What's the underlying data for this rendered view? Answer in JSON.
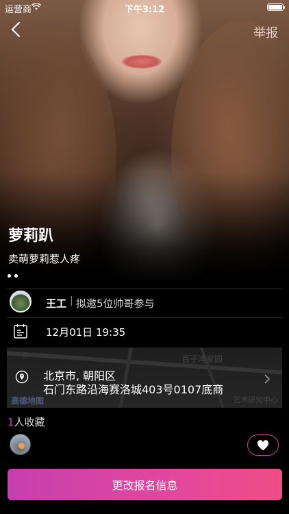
{
  "status_bar": {
    "carrier": "运营商",
    "time": "下午3:12"
  },
  "nav": {
    "report_label": "举报"
  },
  "event": {
    "title": "萝莉趴",
    "subtitle": "卖萌萝莉惹人疼"
  },
  "host": {
    "name": "王工",
    "separator": "|",
    "invite_text": "拟邀5位帅哥参与"
  },
  "schedule": {
    "datetime": "12月01日 19:35"
  },
  "location": {
    "city_district": "北京市, 朝阳区",
    "address": "石门东路沿海赛洛城403号0107底商",
    "map_labels": {
      "top_center": "百子湾家园",
      "top_left": "东",
      "bottom_right": "艺术研究中心"
    },
    "map_logo": "高德地图"
  },
  "favorites": {
    "count": "1",
    "label": "人收藏"
  },
  "cta": {
    "label": "更改报名信息"
  },
  "colors": {
    "accent": "#d0439c",
    "cta_start": "#c63fae",
    "cta_end": "#f04c86",
    "background": "#000000"
  },
  "icons": {
    "back": "chevron-left-icon",
    "calendar": "calendar-icon",
    "location": "location-pin-icon",
    "map_forward": "chevron-right-icon",
    "like": "heart-icon"
  }
}
